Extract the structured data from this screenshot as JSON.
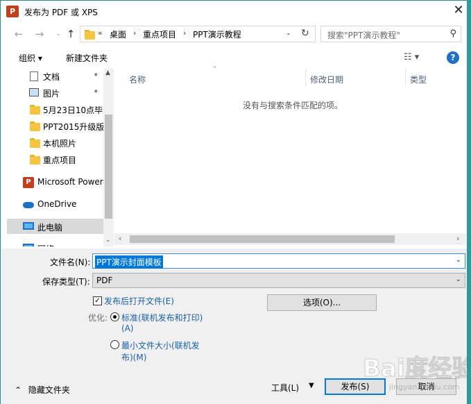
{
  "window": {
    "title": "发布为 PDF 或 XPS",
    "app_icon": "P"
  },
  "address_bar": {
    "overflow": "«",
    "crumbs": [
      "桌面",
      "重点项目",
      "PPT演示教程"
    ],
    "search_placeholder": "搜索\"PPT演示教程\""
  },
  "toolbar": {
    "organize": "组织 ▾",
    "new_folder": "新建文件夹"
  },
  "nav_pane": {
    "items": [
      {
        "label": "文档",
        "pinned": true
      },
      {
        "label": "图片",
        "pinned": true
      },
      {
        "label": "5月23日10点毕业"
      },
      {
        "label": "PPT2015升级版"
      },
      {
        "label": "本机照片"
      },
      {
        "label": "重点项目"
      },
      {
        "label": "Microsoft PowerPoint"
      },
      {
        "label": "OneDrive"
      },
      {
        "label": "此电脑"
      },
      {
        "label": "网络"
      }
    ]
  },
  "file_list": {
    "columns": [
      "名称",
      "修改日期",
      "类型"
    ],
    "empty_message": "没有与搜索条件匹配的项。"
  },
  "form": {
    "filename_label": "文件名(N):",
    "filename_value": "PPT演示封面模板",
    "save_type_label": "保存类型(T):",
    "save_type_value": "PDF",
    "open_after_label": "发布后打开文件(E)",
    "open_after_checked": true,
    "options_button": "选项(O)...",
    "optimize_label": "优化:",
    "opt_standard_line1": "标准(联机发布和打印)",
    "opt_standard_line2": "(A)",
    "opt_min_line1": "最小文件大小(联机发",
    "opt_min_line2": "布)(M)",
    "selected_optimization": "standard",
    "hide_folders": "隐藏文件夹",
    "tools_button": "工具(L)",
    "publish_button": "发布(S)",
    "cancel_button": "取消"
  },
  "watermark": {
    "logo": "Bai度经验",
    "url": "jingyan.baidu.com"
  }
}
